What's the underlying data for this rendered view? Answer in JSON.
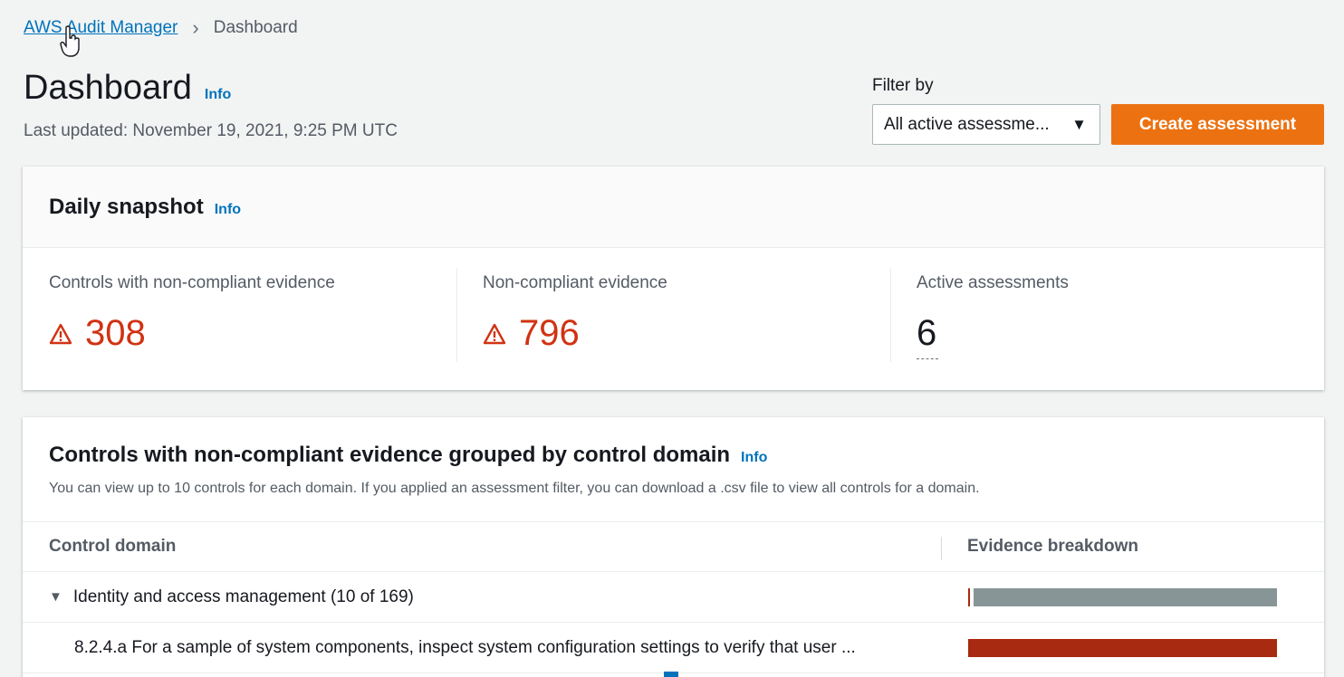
{
  "breadcrumb": {
    "parent": "AWS Audit Manager",
    "current": "Dashboard"
  },
  "header": {
    "title": "Dashboard",
    "info": "Info",
    "last_updated": "Last updated: November 19, 2021, 9:25 PM UTC"
  },
  "filter": {
    "label": "Filter by",
    "selected": "All active assessme..."
  },
  "create_button": "Create assessment",
  "snapshot": {
    "title": "Daily snapshot",
    "info": "Info",
    "metrics": [
      {
        "label": "Controls with non-compliant evidence",
        "value": "308"
      },
      {
        "label": "Non-compliant evidence",
        "value": "796"
      },
      {
        "label": "Active assessments",
        "value": "6"
      }
    ]
  },
  "domains": {
    "title": "Controls with non-compliant evidence grouped by control domain",
    "info": "Info",
    "description": "You can view up to 10 controls for each domain. If you applied an assessment filter, you can download a .csv file to view all controls for a domain.",
    "columns": [
      "Control domain",
      "Evidence breakdown"
    ],
    "rows": [
      {
        "label": "Identity and access management (10 of 169)",
        "breakdown": {
          "noncompliant": 0.005,
          "compliant": 0.995
        }
      },
      {
        "label": "8.2.4.a For a sample of system components, inspect system configuration settings to verify that user ...",
        "breakdown": {
          "noncompliant": 1.0,
          "compliant": 0.0
        }
      }
    ]
  },
  "colors": {
    "accent": "#ec7211",
    "link": "#0073bb",
    "warning": "#d13212",
    "bar_noncompliant": "#a82a10",
    "bar_other": "#879596"
  }
}
